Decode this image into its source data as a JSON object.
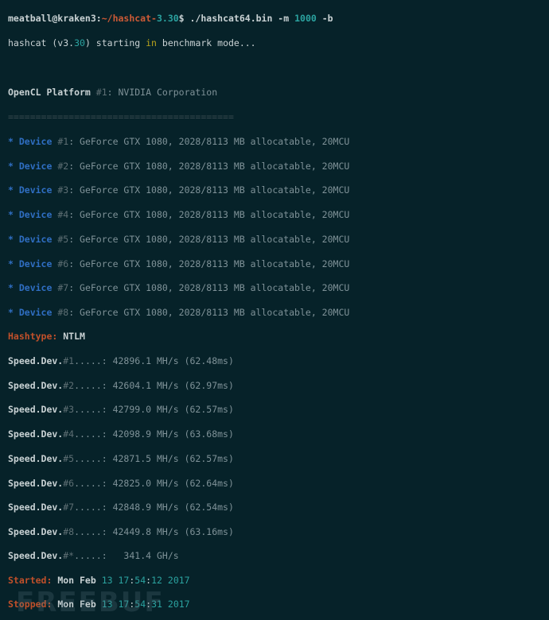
{
  "prompt": {
    "user": "meatball@kraken3",
    "sep": ":",
    "path_pre": "~/hashcat-",
    "version": "3.30",
    "end": "$ ",
    "cmd1": "./hashcat64.bin -m ",
    "cmd_mode": "1000",
    "cmd2": " -b"
  },
  "start_line": {
    "pre": "hashcat (v3.",
    "ver": "30",
    "mid": ") starting ",
    "kw": "in",
    "post": " benchmark mode..."
  },
  "platform": {
    "label": "OpenCL Platform ",
    "num": "#1",
    "rest": ": NVIDIA Corporation"
  },
  "separator": "=========================================",
  "devices": [
    {
      "bullet": "* ",
      "label": "Device ",
      "num": "#1",
      "text": ": GeForce GTX 1080, 2028/8113 MB allocatable, 20MCU"
    },
    {
      "bullet": "* ",
      "label": "Device ",
      "num": "#2",
      "text": ": GeForce GTX 1080, 2028/8113 MB allocatable, 20MCU"
    },
    {
      "bullet": "* ",
      "label": "Device ",
      "num": "#3",
      "text": ": GeForce GTX 1080, 2028/8113 MB allocatable, 20MCU"
    },
    {
      "bullet": "* ",
      "label": "Device ",
      "num": "#4",
      "text": ": GeForce GTX 1080, 2028/8113 MB allocatable, 20MCU"
    },
    {
      "bullet": "* ",
      "label": "Device ",
      "num": "#5",
      "text": ": GeForce GTX 1080, 2028/8113 MB allocatable, 20MCU"
    },
    {
      "bullet": "* ",
      "label": "Device ",
      "num": "#6",
      "text": ": GeForce GTX 1080, 2028/8113 MB allocatable, 20MCU"
    },
    {
      "bullet": "* ",
      "label": "Device ",
      "num": "#7",
      "text": ": GeForce GTX 1080, 2028/8113 MB allocatable, 20MCU"
    },
    {
      "bullet": "* ",
      "label": "Device ",
      "num": "#8",
      "text": ": GeForce GTX 1080, 2028/8113 MB allocatable, 20MCU"
    }
  ],
  "hashtype": {
    "label": "Hashtype:",
    "value": " NTLM"
  },
  "speeds": [
    {
      "label": "Speed.Dev.",
      "num": "#1",
      "dots": ".....: ",
      "value": "42896.1 MH/s (62.48ms)"
    },
    {
      "label": "Speed.Dev.",
      "num": "#2",
      "dots": ".....: ",
      "value": "42604.1 MH/s (62.97ms)"
    },
    {
      "label": "Speed.Dev.",
      "num": "#3",
      "dots": ".....: ",
      "value": "42799.0 MH/s (62.57ms)"
    },
    {
      "label": "Speed.Dev.",
      "num": "#4",
      "dots": ".....: ",
      "value": "42098.9 MH/s (63.68ms)"
    },
    {
      "label": "Speed.Dev.",
      "num": "#5",
      "dots": ".....: ",
      "value": "42871.5 MH/s (62.57ms)"
    },
    {
      "label": "Speed.Dev.",
      "num": "#6",
      "dots": ".....: ",
      "value": "42825.0 MH/s (62.64ms)"
    },
    {
      "label": "Speed.Dev.",
      "num": "#7",
      "dots": ".....: ",
      "value": "42848.9 MH/s (62.54ms)"
    },
    {
      "label": "Speed.Dev.",
      "num": "#8",
      "dots": ".....: ",
      "value": "42449.8 MH/s (63.16ms)"
    }
  ],
  "total": {
    "label": "Speed.Dev.",
    "num": "#*",
    "dots": ".....: ",
    "value": "  341.4 GH/s"
  },
  "started": {
    "label": "Started:",
    "pre": " Mon Feb ",
    "day": "13",
    "sp": " ",
    "h": "17",
    "c1": ":",
    "m": "54",
    "c2": ":",
    "s": "12",
    "sp2": " ",
    "year": "2017"
  },
  "stopped": {
    "label": "Stopped:",
    "pre": " Mon Feb ",
    "day": "13",
    "sp": " ",
    "h": "17",
    "c1": ":",
    "m": "54",
    "c2": ":",
    "s": "31",
    "sp2": " ",
    "year": "2017"
  },
  "watermark": "FREEBUF"
}
